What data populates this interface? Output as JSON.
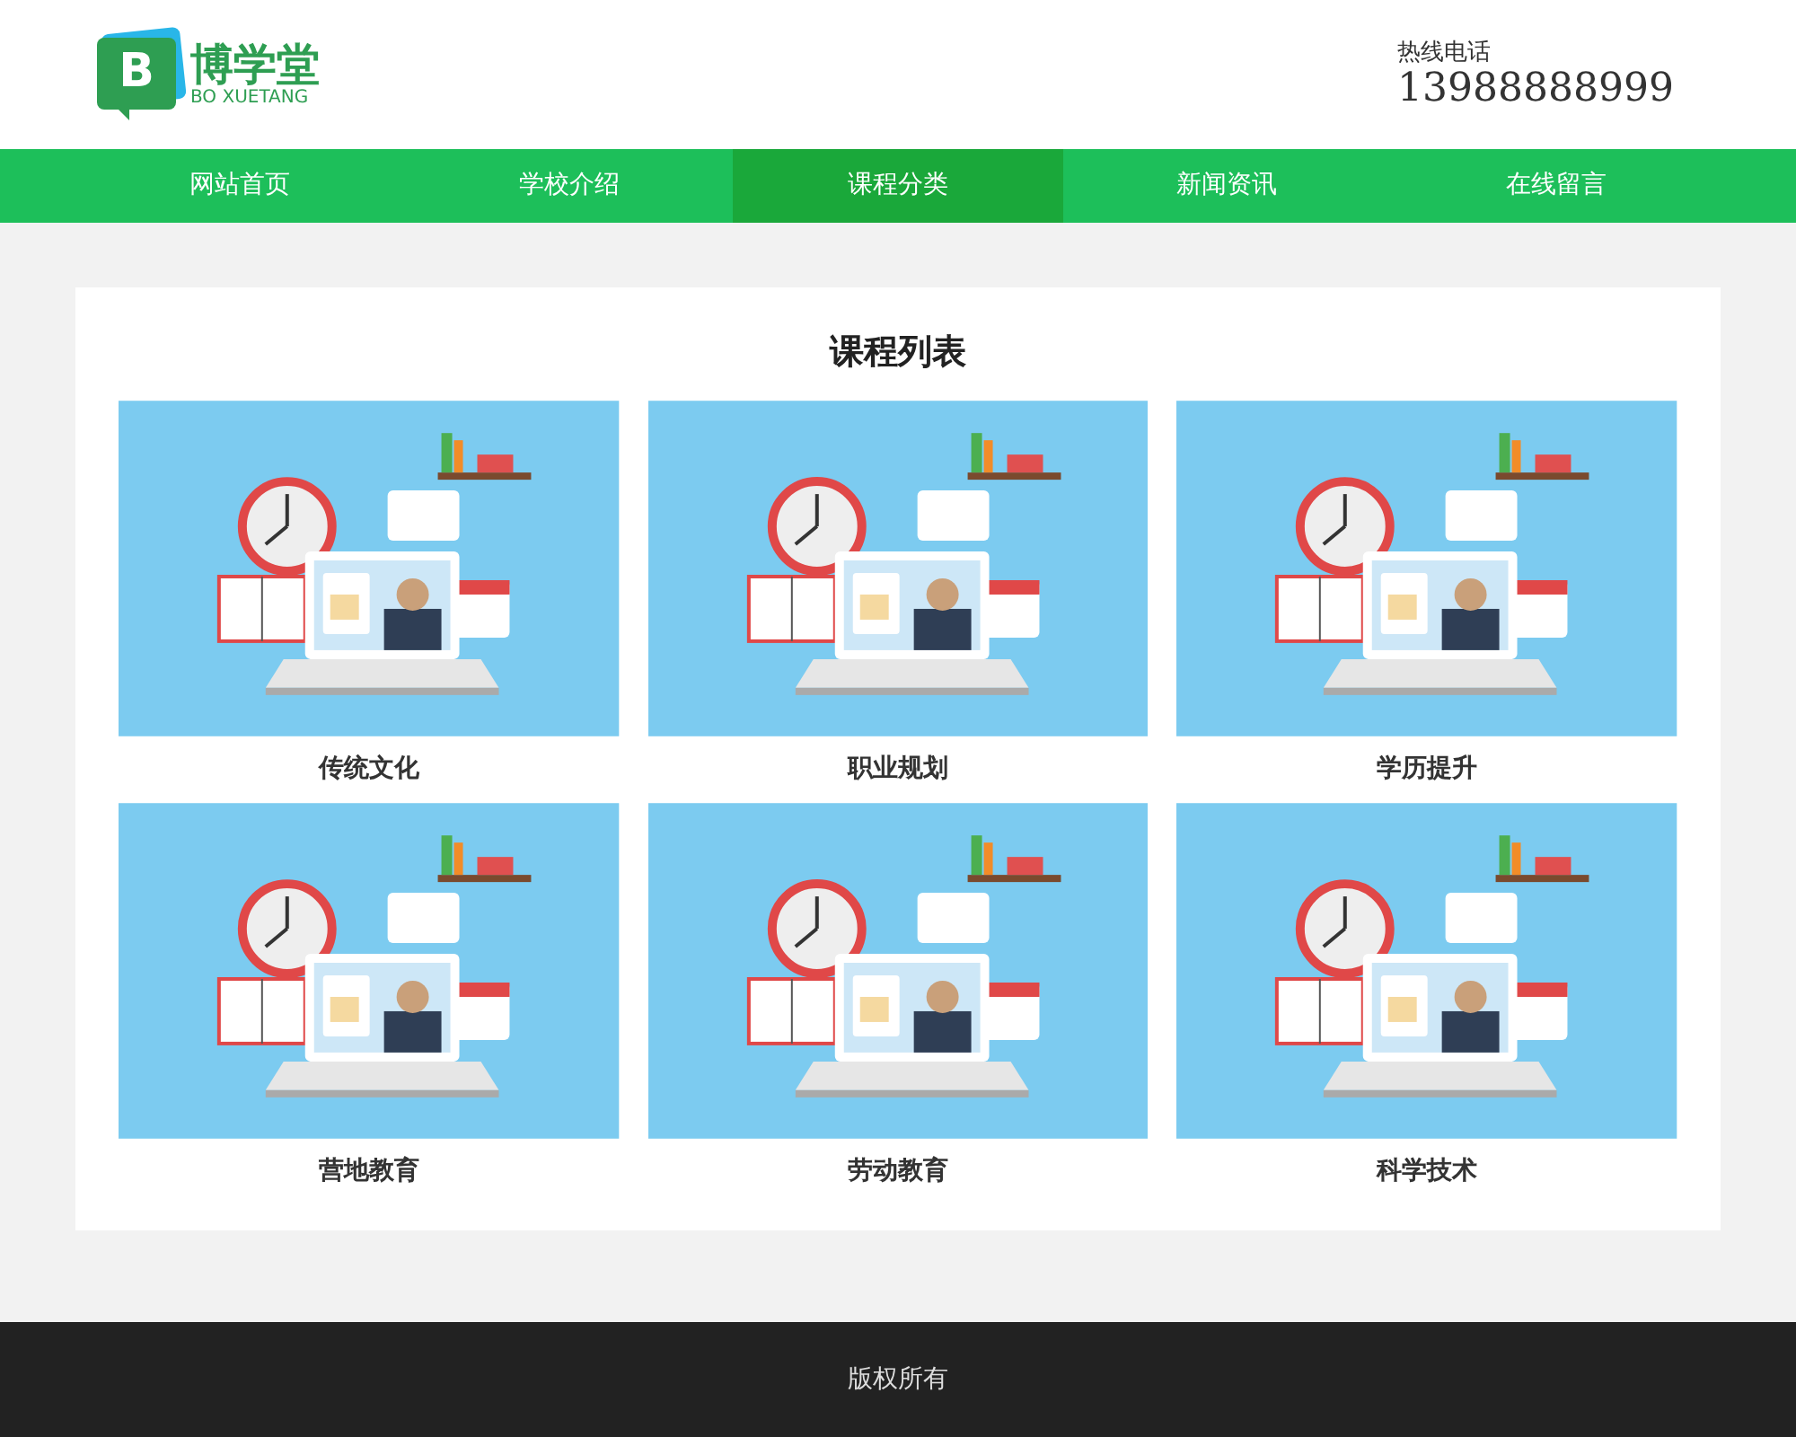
{
  "logo": {
    "letter": "B",
    "name": "博学堂",
    "subtitle": "BO XUETANG"
  },
  "hotline": {
    "label": "热线电话",
    "number": "13988888999"
  },
  "nav": [
    {
      "label": "网站首页",
      "selected": false
    },
    {
      "label": "学校介绍",
      "selected": false
    },
    {
      "label": "课程分类",
      "selected": true
    },
    {
      "label": "新闻资讯",
      "selected": false
    },
    {
      "label": "在线留言",
      "selected": false
    }
  ],
  "courses": {
    "title": "课程列表",
    "items": [
      {
        "name": "传统文化"
      },
      {
        "name": "职业规划"
      },
      {
        "name": "学历提升"
      },
      {
        "name": "营地教育"
      },
      {
        "name": "劳动教育"
      },
      {
        "name": "科学技术"
      }
    ]
  },
  "footer": {
    "text": "版权所有"
  }
}
